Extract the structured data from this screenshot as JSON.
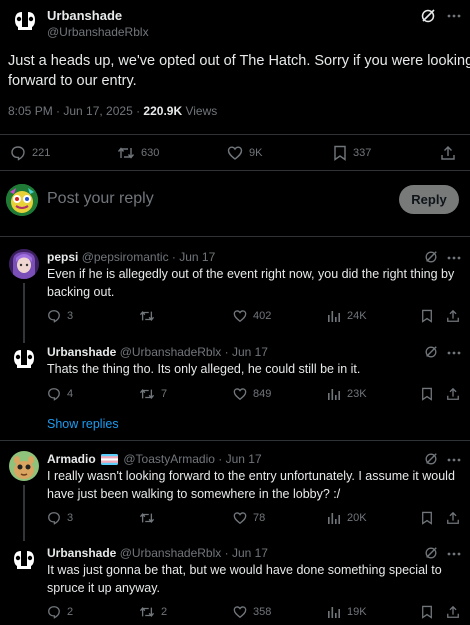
{
  "main_post": {
    "author_name": "Urbanshade",
    "handle": "@UrbanshadeRblx",
    "text_line1": "Just a heads up, we've opted out of The Hatch. Sorry if you were looking",
    "text_line2": "forward to our entry.",
    "timestamp": "8:05 PM · Jun 17, 2025 · ",
    "views_count": "220.9K",
    "views_label": " Views",
    "stats": {
      "replies": "221",
      "reposts": "630",
      "likes": "9K",
      "bookmarks": "337"
    }
  },
  "compose": {
    "placeholder": "Post your reply",
    "reply_button": "Reply"
  },
  "replies": [
    {
      "name": "pepsi",
      "handle": "@pepsiromantic",
      "date": " · Jun 17",
      "line1": "Even if he is allegedly out of the event right now, you did the right thing by",
      "line2": "backing out.",
      "replies": "3",
      "reposts": "",
      "likes": "402",
      "views": "24K"
    },
    {
      "name": "Urbanshade",
      "handle": "@UrbanshadeRblx",
      "date": " · Jun 17",
      "line1": "Thats the thing tho. Its only alleged, he could still be in it.",
      "replies": "4",
      "reposts": "7",
      "likes": "849",
      "views": "23K"
    },
    {
      "name": "Armadio",
      "handle": "@ToastyArmadio",
      "date": " · Jun 17",
      "line1": "I really wasn't looking forward to the entry unfortunately. I assume it would",
      "line2": "have just been walking to somewhere in the lobby? :/",
      "replies": "3",
      "reposts": "",
      "likes": "78",
      "views": "20K"
    },
    {
      "name": "Urbanshade",
      "handle": "@UrbanshadeRblx",
      "date": " · Jun 17",
      "line1": "It was just gonna be that, but we would have done something special to",
      "line2": "spruce it up anyway.",
      "replies": "2",
      "reposts": "2",
      "likes": "358",
      "views": "19K"
    }
  ],
  "show_replies": "Show replies",
  "colors": {
    "accent": "#1d9bf0",
    "reply_button_bg": "#787a7a",
    "divider": "#2f3336"
  }
}
